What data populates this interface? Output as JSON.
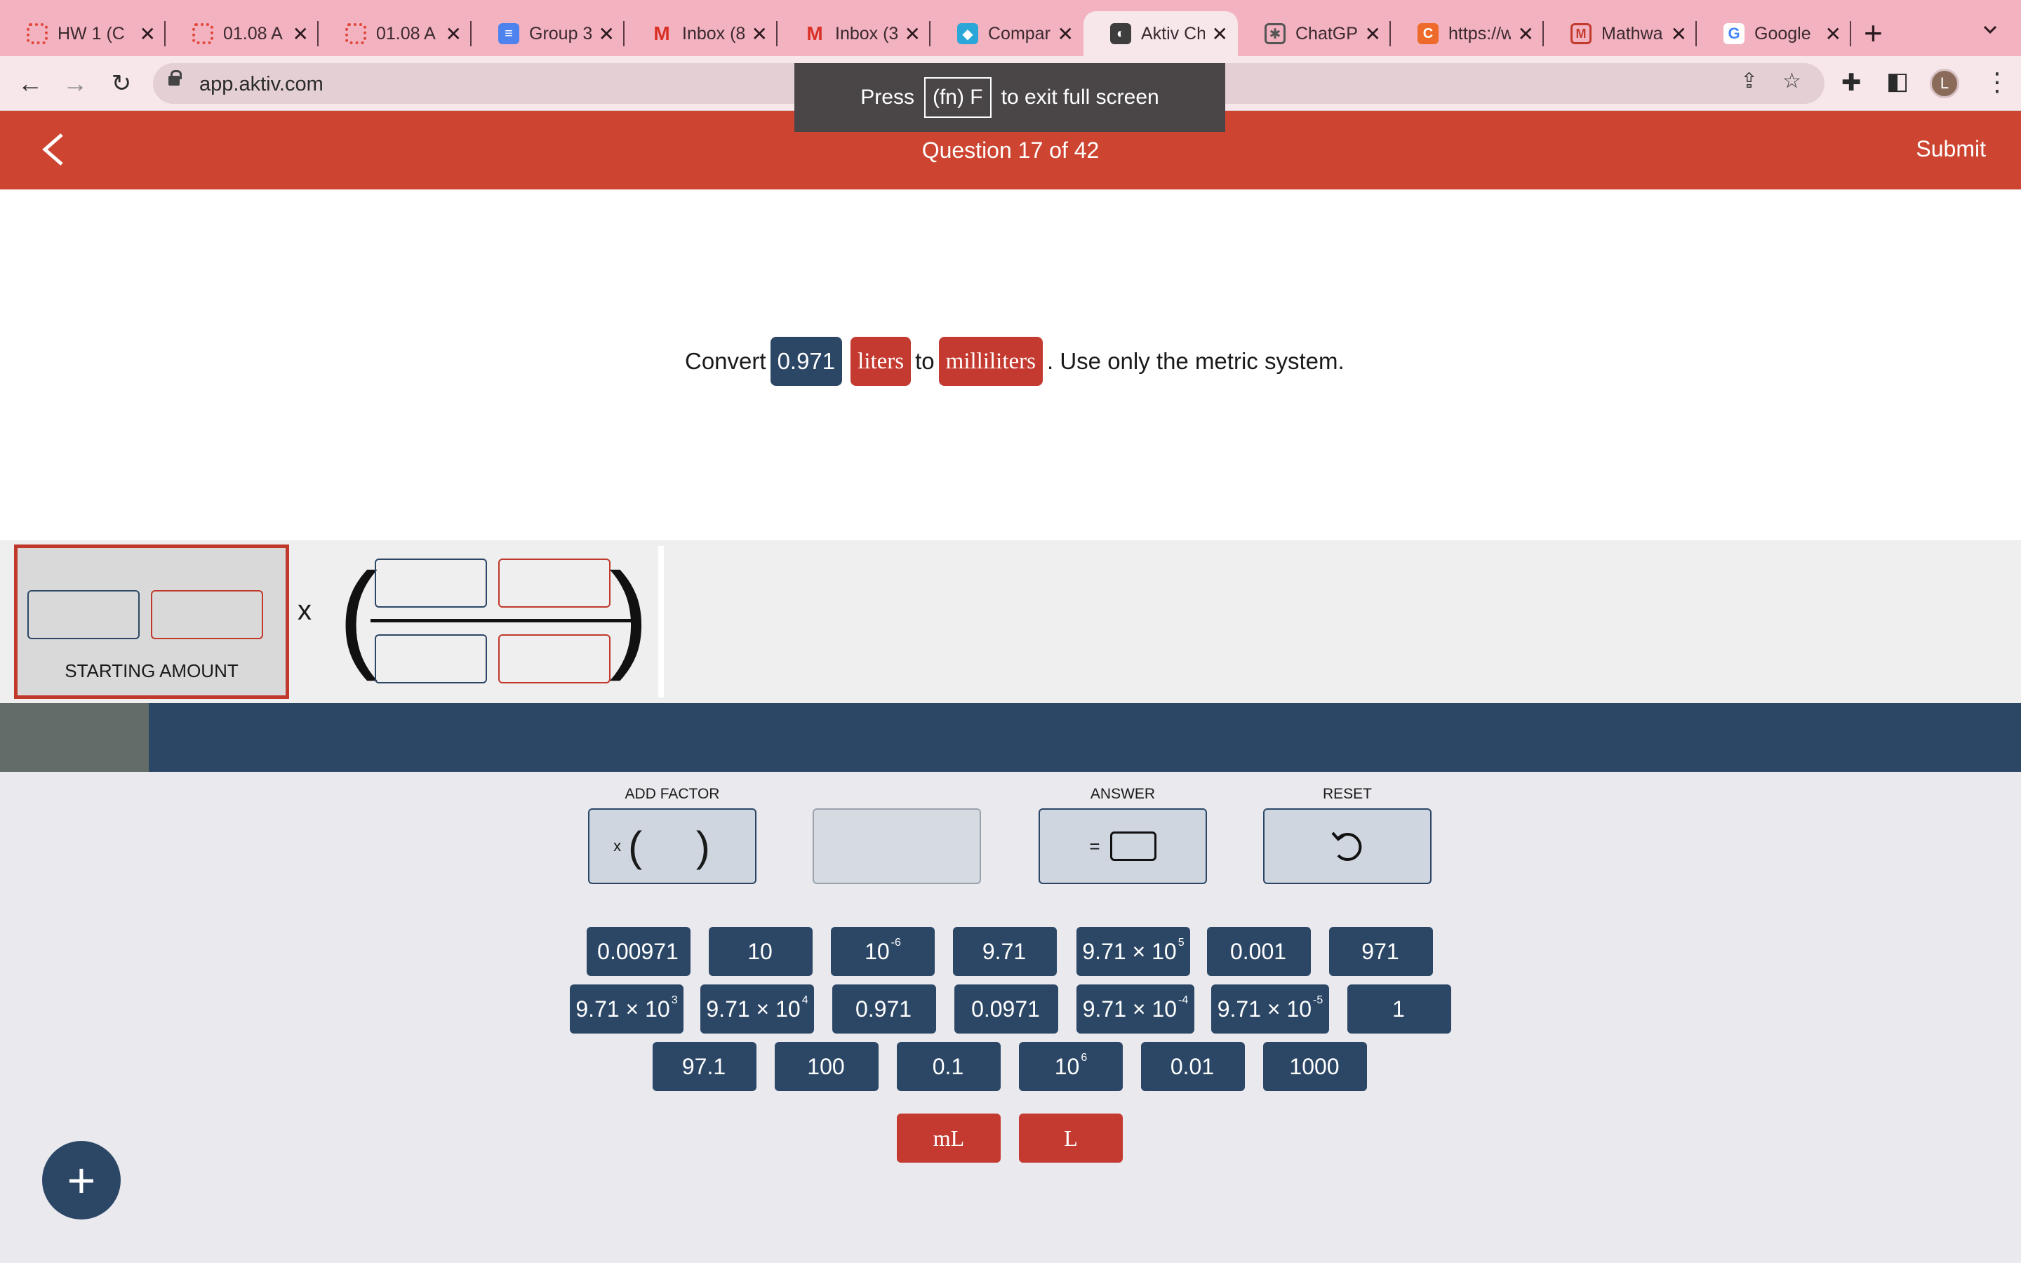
{
  "browser": {
    "tabs": [
      {
        "label": "HW 1 (C",
        "icon": "asu-sunburst-icon"
      },
      {
        "label": "01.08 A",
        "icon": "asu-sunburst-icon"
      },
      {
        "label": "01.08 A",
        "icon": "asu-sunburst-icon"
      },
      {
        "label": "Group 3",
        "icon": "google-docs-icon"
      },
      {
        "label": "Inbox (8",
        "icon": "gmail-icon"
      },
      {
        "label": "Inbox (3",
        "icon": "gmail-icon"
      },
      {
        "label": "Compar",
        "icon": "compare-app-icon"
      },
      {
        "label": "Aktiv Ch",
        "icon": "globe-icon",
        "active": true
      },
      {
        "label": "ChatGP",
        "icon": "chatgpt-icon"
      },
      {
        "label": "https://w",
        "icon": "c-app-icon"
      },
      {
        "label": "Mathwa",
        "icon": "mathway-icon"
      },
      {
        "label": "Google",
        "icon": "google-icon"
      }
    ],
    "url": "app.aktiv.com",
    "profile_initial": "L",
    "fullscreen_tip": {
      "before": "Press",
      "key": "(fn) F",
      "after": "to exit full screen"
    }
  },
  "header": {
    "question_counter": "Question 17 of 42",
    "submit_label": "Submit"
  },
  "question": {
    "prefix": "Convert",
    "value": "0.971",
    "from_unit": "liters",
    "connector": "to",
    "to_unit": "milliliters",
    "suffix": ". Use only the metric system."
  },
  "workspace": {
    "starting_amount_label": "STARTING AMOUNT",
    "times_symbol": "x"
  },
  "actions": {
    "add_factor_label": "ADD FACTOR",
    "add_factor_x": "x",
    "add_factor_parens": "( )",
    "answer_label": "ANSWER",
    "answer_eq": "=",
    "reset_label": "RESET"
  },
  "tiles": {
    "row1": [
      {
        "base": "0.00971",
        "exp": ""
      },
      {
        "base": "10",
        "exp": ""
      },
      {
        "base": "10",
        "exp": "-6"
      },
      {
        "base": "9.71",
        "exp": ""
      },
      {
        "base": "9.71 × 10",
        "exp": "5"
      },
      {
        "base": "0.001",
        "exp": ""
      },
      {
        "base": "971",
        "exp": ""
      }
    ],
    "row2": [
      {
        "base": "9.71 × 10",
        "exp": "3"
      },
      {
        "base": "9.71 × 10",
        "exp": "4"
      },
      {
        "base": "0.971",
        "exp": ""
      },
      {
        "base": "0.0971",
        "exp": ""
      },
      {
        "base": "9.71 × 10",
        "exp": "-4"
      },
      {
        "base": "9.71 × 10",
        "exp": "-5"
      },
      {
        "base": "1",
        "exp": ""
      }
    ],
    "row3": [
      {
        "base": "97.1",
        "exp": ""
      },
      {
        "base": "100",
        "exp": ""
      },
      {
        "base": "0.1",
        "exp": ""
      },
      {
        "base": "10",
        "exp": "6"
      },
      {
        "base": "0.01",
        "exp": ""
      },
      {
        "base": "1000",
        "exp": ""
      }
    ],
    "units": [
      {
        "label": "mL"
      },
      {
        "label": "L"
      }
    ]
  },
  "fab": {
    "label": "+"
  },
  "colors": {
    "tab_strip": "#f3b2bf",
    "header_red": "#cd4531",
    "navy": "#2c4766",
    "unit_red": "#c53a30",
    "page_bg": "#e9e9ee"
  }
}
